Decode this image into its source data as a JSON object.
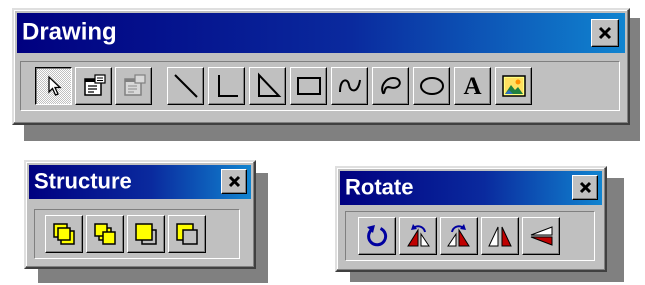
{
  "drawing": {
    "title": "Drawing",
    "text_tool_label": "A",
    "tools": [
      "select-tool",
      "properties-tool",
      "properties-tool-disabled",
      "line-tool",
      "elbow-line-tool",
      "triangle-tool",
      "rectangle-tool",
      "curve-tool",
      "freeform-tool",
      "ellipse-tool",
      "text-tool",
      "image-tool"
    ],
    "selected_tool": "select-tool"
  },
  "structure": {
    "title": "Structure",
    "tools": [
      "bring-to-front",
      "send-to-back",
      "bring-forward",
      "send-backward"
    ]
  },
  "rotate": {
    "title": "Rotate",
    "tools": [
      "free-rotate",
      "rotate-left",
      "rotate-right",
      "flip-horizontal",
      "flip-vertical"
    ]
  },
  "colors": {
    "title_gradient_start": "#000080",
    "title_gradient_end": "#1084d0",
    "face": "#c0c0c0",
    "shape_fill_yellow": "#ffff00",
    "rotate_red": "#c00000",
    "rotate_blue": "#0000a0"
  }
}
